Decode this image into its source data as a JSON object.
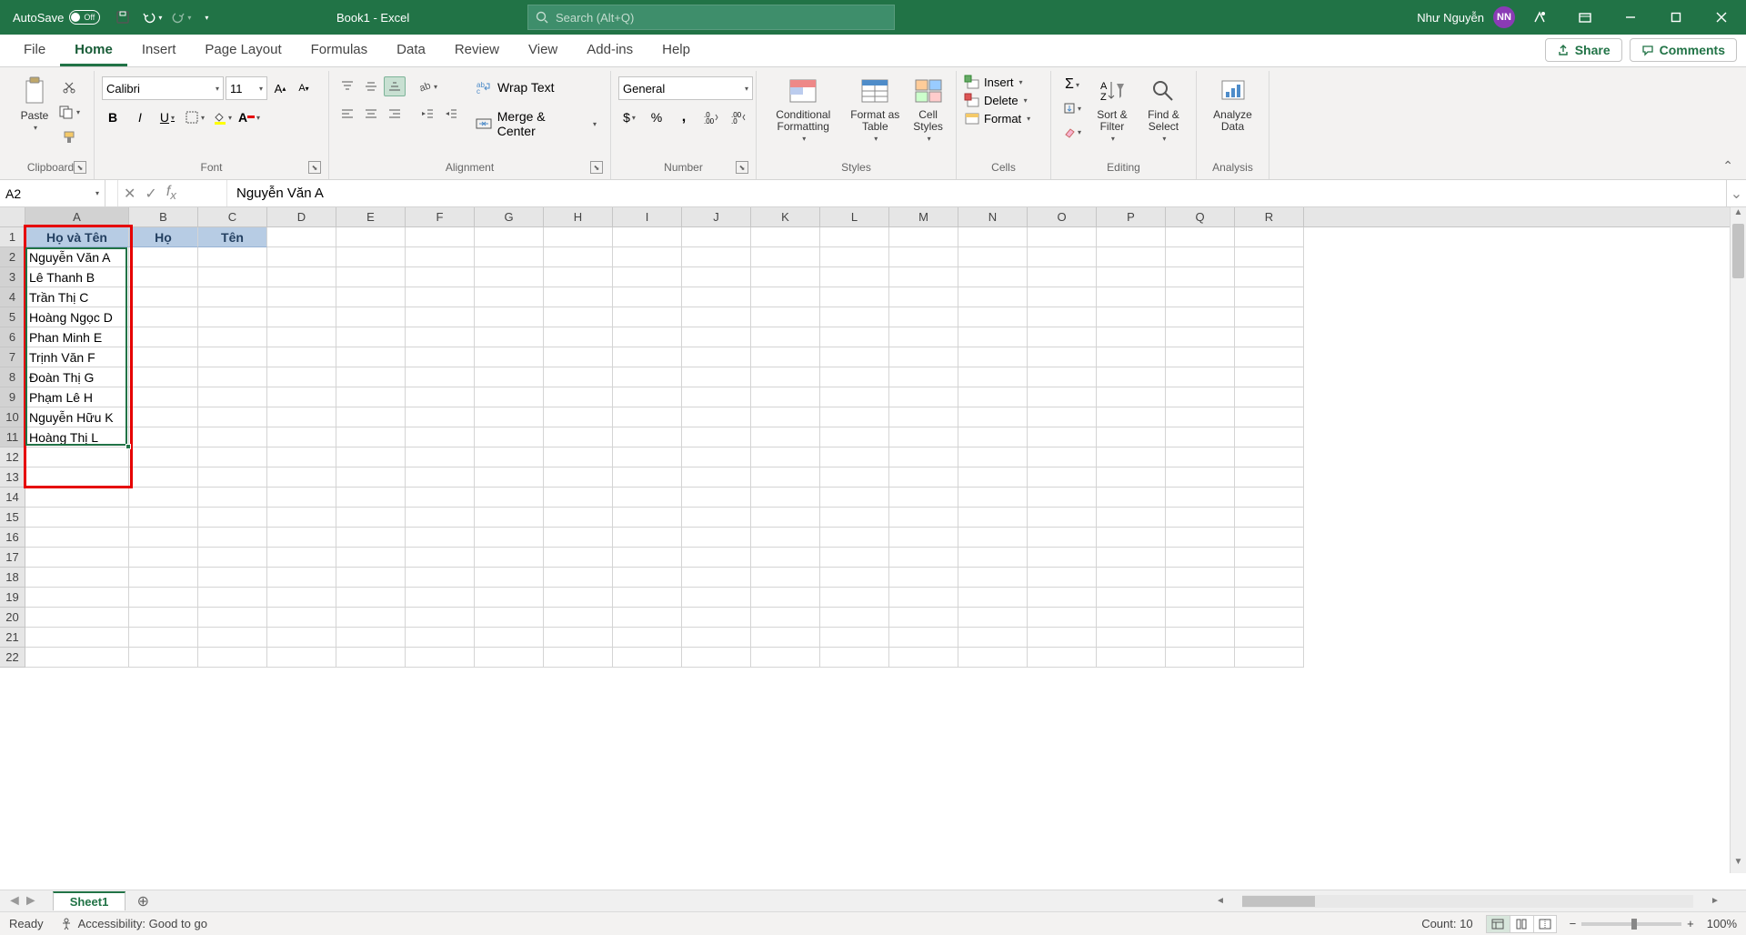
{
  "titlebar": {
    "autosave": "AutoSave",
    "autosave_state": "Off",
    "book_title": "Book1  -  Excel",
    "search_placeholder": "Search (Alt+Q)",
    "user_name": "Như Nguyễn",
    "user_initials": "NN"
  },
  "tabs": {
    "file": "File",
    "home": "Home",
    "insert": "Insert",
    "page_layout": "Page Layout",
    "formulas": "Formulas",
    "data": "Data",
    "review": "Review",
    "view": "View",
    "addins": "Add-ins",
    "help": "Help",
    "share": "Share",
    "comments": "Comments"
  },
  "ribbon": {
    "clipboard": {
      "label": "Clipboard",
      "paste": "Paste"
    },
    "font": {
      "label": "Font",
      "name": "Calibri",
      "size": "11"
    },
    "alignment": {
      "label": "Alignment",
      "wrap": "Wrap Text",
      "merge": "Merge & Center"
    },
    "number": {
      "label": "Number",
      "format": "General"
    },
    "styles": {
      "label": "Styles",
      "conditional": "Conditional Formatting",
      "table": "Format as Table",
      "cellstyles": "Cell Styles"
    },
    "cells": {
      "label": "Cells",
      "insert": "Insert",
      "delete": "Delete",
      "format": "Format"
    },
    "editing": {
      "label": "Editing",
      "sort": "Sort & Filter",
      "find": "Find & Select"
    },
    "analysis": {
      "label": "Analysis",
      "analyze": "Analyze Data"
    }
  },
  "formula_bar": {
    "name_box": "A2",
    "formula": "Nguyễn Văn A"
  },
  "columns": [
    "A",
    "B",
    "C",
    "D",
    "E",
    "F",
    "G",
    "H",
    "I",
    "J",
    "K",
    "L",
    "M",
    "N",
    "O",
    "P",
    "Q",
    "R"
  ],
  "col_widths": {
    "A": 114,
    "default": 76
  },
  "headers": {
    "A": "Họ và Tên",
    "B": "Họ",
    "C": "Tên"
  },
  "data_rows": [
    "Nguyễn Văn A",
    "Lê Thanh B",
    "Trần Thị C",
    "Hoàng Ngọc D",
    "Phan Minh E",
    "Trịnh Văn F",
    "Đoàn Thị G",
    "Phạm Lê H",
    "Nguyễn Hữu K",
    "Hoàng Thị L"
  ],
  "total_rows": 22,
  "sheet": {
    "name": "Sheet1"
  },
  "status": {
    "ready": "Ready",
    "accessibility": "Accessibility: Good to go",
    "count": "Count: 10",
    "zoom": "100%"
  }
}
